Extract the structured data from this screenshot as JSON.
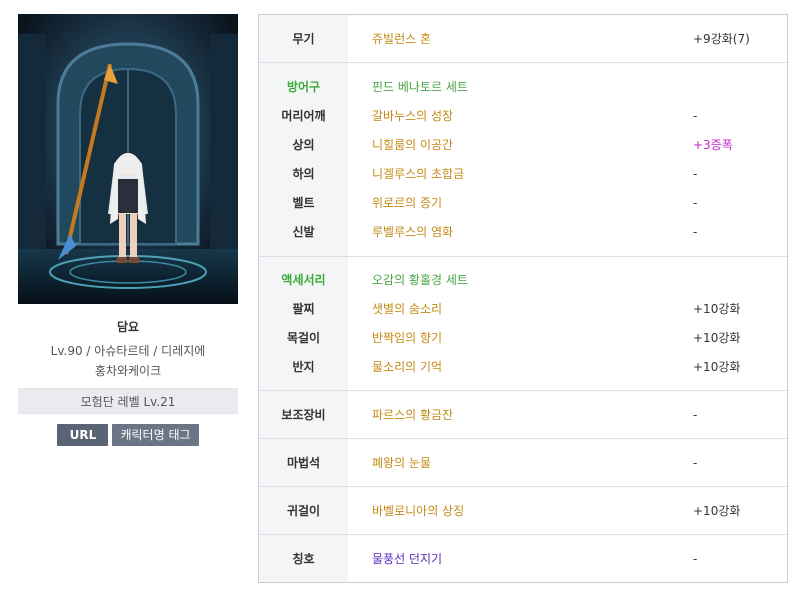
{
  "character": {
    "name": "담요",
    "info_line1": "Lv.90 / 아슈타르테 / 디레지에",
    "info_line2": "홍차와케이크",
    "adventure_level": "모험단 레벨 Lv.21",
    "url_button": "URL",
    "tag_button": "캐릭터명 태그"
  },
  "colors": {
    "item_name": "#c38a14",
    "set_name": "#4aa64a",
    "category_green": "#3aaa3a",
    "enchant_magenta": "#c026c4",
    "title_purple": "#5b2ec0"
  },
  "equipment": {
    "weapon": {
      "label": "무기",
      "name": "쥬빌런스 혼",
      "value": "+9강화(7)"
    },
    "armor": {
      "label": "방어구",
      "set_name": "핀드 베나토르 세트",
      "items": [
        {
          "label": "머리어깨",
          "name": "갈바누스의 성장",
          "value": "-"
        },
        {
          "label": "상의",
          "name": "니힐룸의 이공간",
          "value": "+3증폭"
        },
        {
          "label": "하의",
          "name": "니겔루스의 초합금",
          "value": "-"
        },
        {
          "label": "벨트",
          "name": "위로르의 증기",
          "value": "-"
        },
        {
          "label": "신발",
          "name": "루벨루스의 염화",
          "value": "-"
        }
      ]
    },
    "accessory": {
      "label": "액세서리",
      "set_name": "오감의 황홀경 세트",
      "items": [
        {
          "label": "팔찌",
          "name": "샛별의 숨소리",
          "value": "+10강화"
        },
        {
          "label": "목걸이",
          "name": "반짝임의 향기",
          "value": "+10강화"
        },
        {
          "label": "반지",
          "name": "물소리의 기억",
          "value": "+10강화"
        }
      ]
    },
    "subweapon": {
      "label": "보조장비",
      "name": "파르스의 황금잔",
      "value": "-"
    },
    "magicstone": {
      "label": "마법석",
      "name": "폐왕의 눈물",
      "value": "-"
    },
    "earring": {
      "label": "귀걸이",
      "name": "바벨로니아의 상징",
      "value": "+10강화"
    },
    "title": {
      "label": "칭호",
      "name": "물풍선 던지기",
      "value": "-"
    }
  }
}
